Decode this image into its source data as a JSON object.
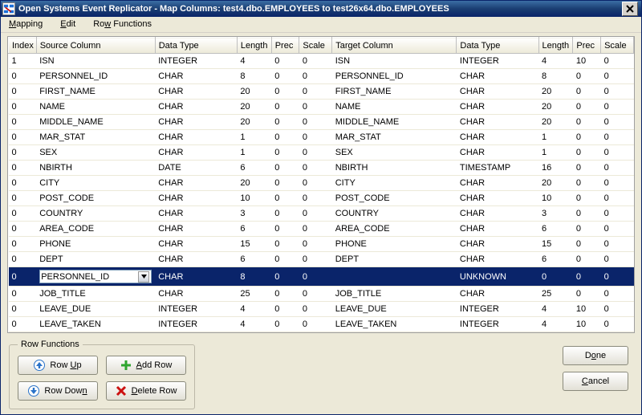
{
  "window": {
    "title": "Open Systems Event Replicator - Map Columns:   test4.dbo.EMPLOYEES  to  test26x64.dbo.EMPLOYEES"
  },
  "menu": {
    "mapping": "Mapping",
    "edit": "Edit",
    "row_functions": "Row Functions"
  },
  "headers": {
    "index": "Index",
    "source_column": "Source Column",
    "data_type": "Data Type",
    "length": "Length",
    "prec": "Prec",
    "scale": "Scale",
    "target_column": "Target Column",
    "data_type2": "Data Type",
    "length2": "Length",
    "prec2": "Prec",
    "scale2": "Scale"
  },
  "rows": [
    {
      "idx": "1",
      "sc": "ISN",
      "dt": "INTEGER",
      "len": "4",
      "prec": "0",
      "scale": "0",
      "tc": "ISN",
      "dt2": "INTEGER",
      "len2": "4",
      "prec2": "10",
      "scale2": "0",
      "sel": false
    },
    {
      "idx": "0",
      "sc": "PERSONNEL_ID",
      "dt": "CHAR",
      "len": "8",
      "prec": "0",
      "scale": "0",
      "tc": "PERSONNEL_ID",
      "dt2": "CHAR",
      "len2": "8",
      "prec2": "0",
      "scale2": "0",
      "sel": false
    },
    {
      "idx": "0",
      "sc": "FIRST_NAME",
      "dt": "CHAR",
      "len": "20",
      "prec": "0",
      "scale": "0",
      "tc": "FIRST_NAME",
      "dt2": "CHAR",
      "len2": "20",
      "prec2": "0",
      "scale2": "0",
      "sel": false
    },
    {
      "idx": "0",
      "sc": "NAME",
      "dt": "CHAR",
      "len": "20",
      "prec": "0",
      "scale": "0",
      "tc": "NAME",
      "dt2": "CHAR",
      "len2": "20",
      "prec2": "0",
      "scale2": "0",
      "sel": false
    },
    {
      "idx": "0",
      "sc": "MIDDLE_NAME",
      "dt": "CHAR",
      "len": "20",
      "prec": "0",
      "scale": "0",
      "tc": "MIDDLE_NAME",
      "dt2": "CHAR",
      "len2": "20",
      "prec2": "0",
      "scale2": "0",
      "sel": false
    },
    {
      "idx": "0",
      "sc": "MAR_STAT",
      "dt": "CHAR",
      "len": "1",
      "prec": "0",
      "scale": "0",
      "tc": "MAR_STAT",
      "dt2": "CHAR",
      "len2": "1",
      "prec2": "0",
      "scale2": "0",
      "sel": false
    },
    {
      "idx": "0",
      "sc": "SEX",
      "dt": "CHAR",
      "len": "1",
      "prec": "0",
      "scale": "0",
      "tc": "SEX",
      "dt2": "CHAR",
      "len2": "1",
      "prec2": "0",
      "scale2": "0",
      "sel": false
    },
    {
      "idx": "0",
      "sc": "NBIRTH",
      "dt": "DATE",
      "len": "6",
      "prec": "0",
      "scale": "0",
      "tc": "NBIRTH",
      "dt2": "TIMESTAMP",
      "len2": "16",
      "prec2": "0",
      "scale2": "0",
      "sel": false
    },
    {
      "idx": "0",
      "sc": "CITY",
      "dt": "CHAR",
      "len": "20",
      "prec": "0",
      "scale": "0",
      "tc": "CITY",
      "dt2": "CHAR",
      "len2": "20",
      "prec2": "0",
      "scale2": "0",
      "sel": false
    },
    {
      "idx": "0",
      "sc": "POST_CODE",
      "dt": "CHAR",
      "len": "10",
      "prec": "0",
      "scale": "0",
      "tc": "POST_CODE",
      "dt2": "CHAR",
      "len2": "10",
      "prec2": "0",
      "scale2": "0",
      "sel": false
    },
    {
      "idx": "0",
      "sc": "COUNTRY",
      "dt": "CHAR",
      "len": "3",
      "prec": "0",
      "scale": "0",
      "tc": "COUNTRY",
      "dt2": "CHAR",
      "len2": "3",
      "prec2": "0",
      "scale2": "0",
      "sel": false
    },
    {
      "idx": "0",
      "sc": "AREA_CODE",
      "dt": "CHAR",
      "len": "6",
      "prec": "0",
      "scale": "0",
      "tc": "AREA_CODE",
      "dt2": "CHAR",
      "len2": "6",
      "prec2": "0",
      "scale2": "0",
      "sel": false
    },
    {
      "idx": "0",
      "sc": "PHONE",
      "dt": "CHAR",
      "len": "15",
      "prec": "0",
      "scale": "0",
      "tc": "PHONE",
      "dt2": "CHAR",
      "len2": "15",
      "prec2": "0",
      "scale2": "0",
      "sel": false
    },
    {
      "idx": "0",
      "sc": "DEPT",
      "dt": "CHAR",
      "len": "6",
      "prec": "0",
      "scale": "0",
      "tc": "DEPT",
      "dt2": "CHAR",
      "len2": "6",
      "prec2": "0",
      "scale2": "0",
      "sel": false
    },
    {
      "idx": "0",
      "sc": "PERSONNEL_ID",
      "dt": "CHAR",
      "len": "8",
      "prec": "0",
      "scale": "0",
      "tc": "",
      "dt2": "UNKNOWN",
      "len2": "0",
      "prec2": "0",
      "scale2": "0",
      "sel": true
    },
    {
      "idx": "0",
      "sc": "JOB_TITLE",
      "dt": "CHAR",
      "len": "25",
      "prec": "0",
      "scale": "0",
      "tc": "JOB_TITLE",
      "dt2": "CHAR",
      "len2": "25",
      "prec2": "0",
      "scale2": "0",
      "sel": false
    },
    {
      "idx": "0",
      "sc": "LEAVE_DUE",
      "dt": "INTEGER",
      "len": "4",
      "prec": "0",
      "scale": "0",
      "tc": "LEAVE_DUE",
      "dt2": "INTEGER",
      "len2": "4",
      "prec2": "10",
      "scale2": "0",
      "sel": false
    },
    {
      "idx": "0",
      "sc": "LEAVE_TAKEN",
      "dt": "INTEGER",
      "len": "4",
      "prec": "0",
      "scale": "0",
      "tc": "LEAVE_TAKEN",
      "dt2": "INTEGER",
      "len2": "4",
      "prec2": "10",
      "scale2": "0",
      "sel": false
    }
  ],
  "row_functions": {
    "legend": "Row Functions",
    "row_up": "Row Up",
    "row_down": "Row Down",
    "add_row": "Add Row",
    "delete_row": "Delete Row"
  },
  "buttons": {
    "done": "Done",
    "cancel": "Cancel"
  },
  "icons": {
    "app": "osr-icon",
    "close": "close-icon",
    "up": "arrow-up-icon",
    "down": "arrow-down-icon",
    "add": "plus-icon",
    "delete": "x-icon",
    "chevron": "chevron-down-icon"
  }
}
